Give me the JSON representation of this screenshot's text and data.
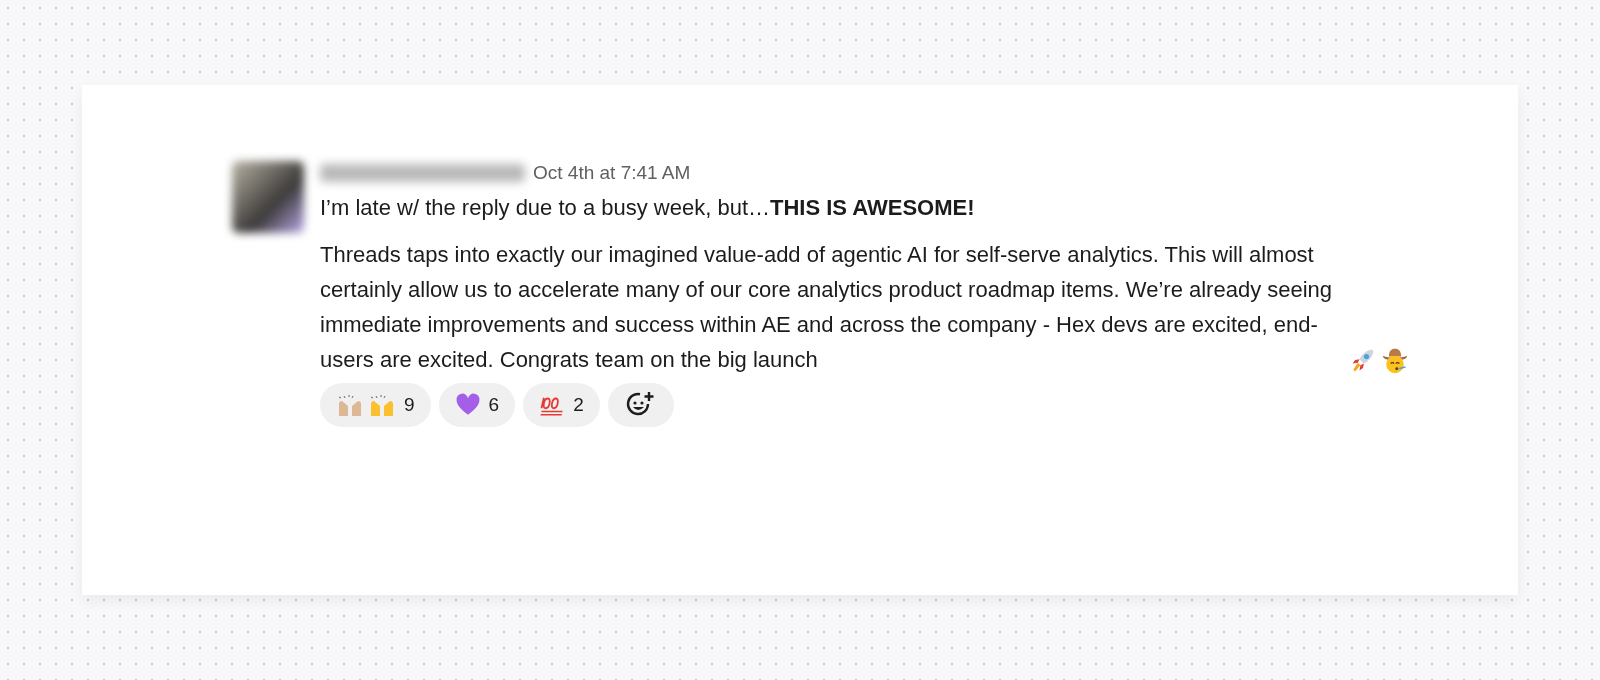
{
  "message": {
    "timestamp": "Oct 4th at 7:41 AM",
    "lead": "I’m late w/ the reply due to a busy week, but…**THIS IS AWESOME!**",
    "body": "Threads taps into exactly our imagined value-add of agentic AI for self-serve analytics. This will almost certainly allow us to accelerate many of our core analytics product roadmap items. We’re already seeing immediate improvements and success within AE and across the company - Hex devs are excited, end-users are excited. Congrats team on the big launch",
    "trailing_emojis": [
      {
        "kind": "rocket"
      },
      {
        "kind": "cowboy"
      }
    ]
  },
  "reactions": [
    {
      "kind": "hands",
      "count": "9"
    },
    {
      "kind": "heart",
      "count": "6"
    },
    {
      "kind": "hundred",
      "count": "2"
    }
  ]
}
